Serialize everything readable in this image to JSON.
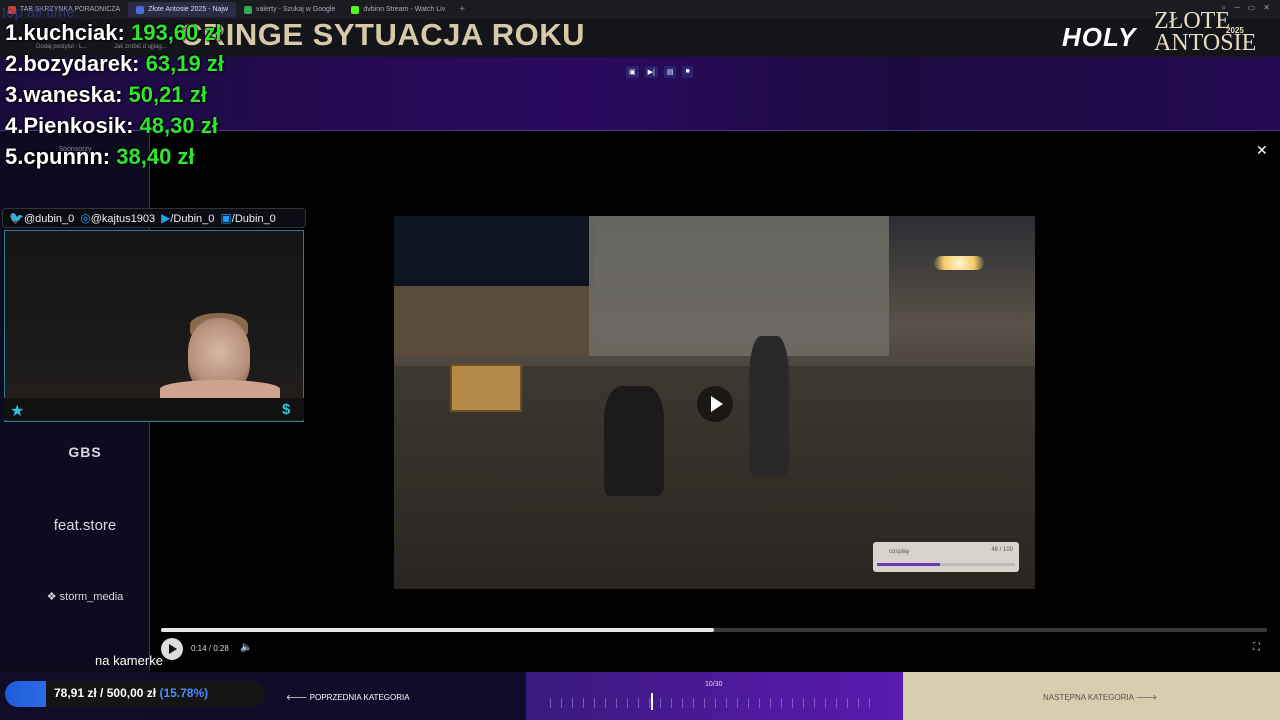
{
  "browser": {
    "tabs": [
      {
        "label": "TAB SKRZYNKA PORADNICZA",
        "active": false,
        "color": "#c43"
      },
      {
        "label": "Złote Antosie 2025 - Najw",
        "active": true,
        "color": "#4d6bd8"
      },
      {
        "label": "valerty - Szukaj w Google",
        "active": false,
        "color": "#34a853"
      },
      {
        "label": "dvbinn Stream - Watch Liv",
        "active": false,
        "color": "#53fc18"
      }
    ],
    "bookmarks": [
      "Dodaj postyluł - L...",
      "Jak zrobić d ujjiag..."
    ]
  },
  "overlay": {
    "top_label": "top all time",
    "leaderboard": [
      {
        "rank": "1.",
        "name": "kuchciak:",
        "amount": "193,60 zł"
      },
      {
        "rank": "2.",
        "name": "bozydarek:",
        "amount": "63,19 zł"
      },
      {
        "rank": "3.",
        "name": "waneska:",
        "amount": "50,21 zł"
      },
      {
        "rank": "4.",
        "name": "Pienkosik:",
        "amount": "48,30 zł"
      },
      {
        "rank": "5.",
        "name": "cpunnn:",
        "amount": "38,40 zł"
      }
    ],
    "caption": "na kamerke",
    "goal": {
      "current": "78,91 zł",
      "separator": "/",
      "target": "500,00 zł",
      "percent_label": "(15.78%)",
      "fraction": 0.1578
    }
  },
  "webcam": {
    "social": [
      {
        "icon": "twitter-icon",
        "handle": "@dubin_0"
      },
      {
        "icon": "instagram-icon",
        "handle": "@kajtus1903"
      },
      {
        "icon": "youtube-icon",
        "handle": "/Dubin_0"
      },
      {
        "icon": "twitch-icon",
        "handle": "/Dubin_0"
      }
    ]
  },
  "header": {
    "category_title": "CRINGE SYTUACJA ROKU",
    "logo_holy": "HOLY",
    "logo_zlote": "ZŁOTE",
    "logo_antosie": "ANTOSIE",
    "logo_year": "2025"
  },
  "sidebar": {
    "sponsors_label": "Sponsorzy",
    "sponsors": [
      "GBS",
      "feat.store",
      "storm_media"
    ]
  },
  "video_overlay": {
    "label": "cosplay",
    "count": "46 / 100",
    "sub": "Zobacz więcej",
    "fraction": 0.46
  },
  "player": {
    "time": "0:14 / 0:28",
    "progress": 0.5
  },
  "bottom": {
    "prev_label": "POPRZEDNIA KATEGORIA",
    "counter": "10/30",
    "next_label": "NASTĘPNA KATEGORIA",
    "current_index": 10,
    "total": 30
  }
}
